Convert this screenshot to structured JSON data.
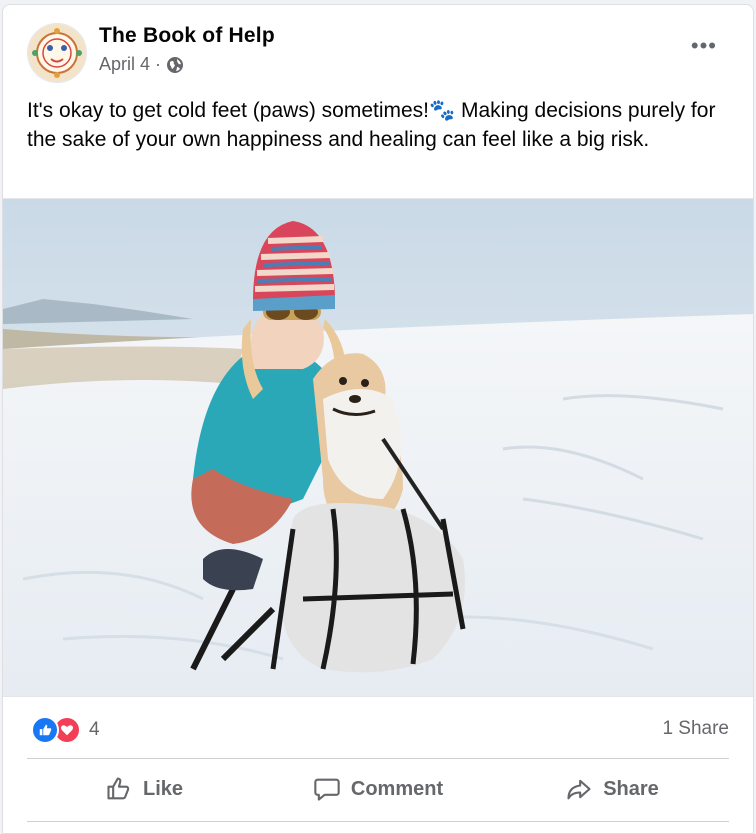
{
  "post": {
    "page_name": "The Book of Help",
    "date": "April 4",
    "separator": "·",
    "text": "It's okay to get cold feet (paws) sometimes!🐾 Making decisions purely for the sake of your own happiness and healing can feel like a big risk.",
    "more_label": "•••"
  },
  "stats": {
    "reaction_count": "4",
    "share_count": "1 Share",
    "reactions": [
      "like-icon",
      "love-icon"
    ]
  },
  "actions": {
    "like": "Like",
    "comment": "Comment",
    "share": "Share"
  },
  "colors": {
    "like_blue": "#1877f2",
    "love_red": "#f33e58",
    "muted": "#65676b"
  }
}
